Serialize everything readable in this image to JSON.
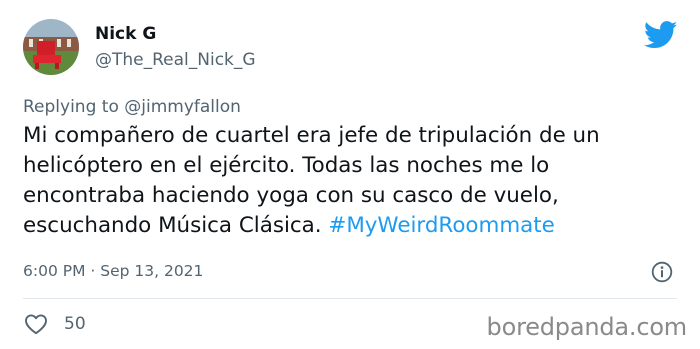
{
  "user": {
    "name": "Nick G",
    "handle": "@The_Real_Nick_G"
  },
  "reply": {
    "prefix": "Replying to ",
    "mention": "@jimmyfallon"
  },
  "tweet": {
    "text": "Mi compañero de cuartel era jefe de tripulación de un helicóptero en el ejército. Todas las noches me lo encontraba haciendo yoga con su casco de vuelo, escuchando Música Clásica. ",
    "hashtag": "#MyWeirdRoommate"
  },
  "meta": {
    "timestamp": "6:00 PM · Sep 13, 2021"
  },
  "stats": {
    "likes": "50"
  },
  "watermark": "boredpanda.com",
  "colors": {
    "accent": "#1d9bf0",
    "secondary_text": "#536471",
    "primary_text": "#0f1419"
  },
  "icons": {
    "brand": "twitter-bird-icon",
    "info": "info-icon",
    "like": "heart-icon"
  }
}
